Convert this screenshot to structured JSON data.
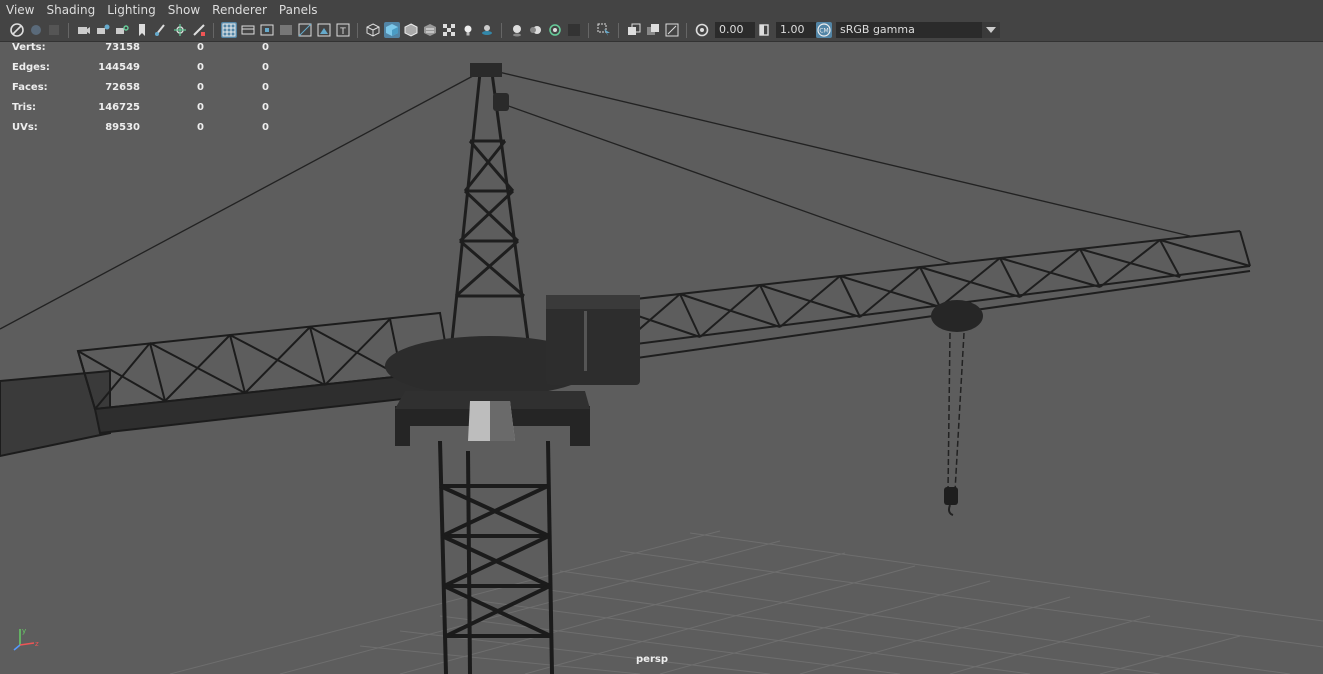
{
  "menu": [
    "View",
    "Shading",
    "Lighting",
    "Show",
    "Renderer",
    "Panels"
  ],
  "toolbar": {
    "exposure": "0.00",
    "gamma": "1.00",
    "color_space": "sRGB gamma"
  },
  "hud": [
    {
      "label": "Verts:",
      "v1": "73158",
      "v2": "0",
      "v3": "0"
    },
    {
      "label": "Edges:",
      "v1": "144549",
      "v2": "0",
      "v3": "0"
    },
    {
      "label": "Faces:",
      "v1": "72658",
      "v2": "0",
      "v3": "0"
    },
    {
      "label": "Tris:",
      "v1": "146725",
      "v2": "0",
      "v3": "0"
    },
    {
      "label": "UVs:",
      "v1": "89530",
      "v2": "0",
      "v3": "0"
    }
  ],
  "camera": "persp",
  "colors": {
    "accent": "#5285a6",
    "viewport_bg": "#5d5d5d",
    "panel_bg": "#444444"
  },
  "icons": [
    "select-camera-icon",
    "camera-attributes-icon",
    "bookmark-icon",
    "grease-pencil-icon",
    "image-plane-icon",
    "grid-icon",
    "film-gate-icon",
    "resolution-gate-icon",
    "gate-mask-icon",
    "field-chart-icon",
    "safe-action-icon",
    "safe-title-icon",
    "wireframe-icon",
    "smooth-shade-icon",
    "wireframe-on-shaded-icon",
    "textured-icon",
    "lights-icon",
    "shadows-icon",
    "ambient-occlusion-icon",
    "motion-blur-icon",
    "anti-aliasing-icon",
    "depth-of-field-icon",
    "isolate-select-icon",
    "xray-icon",
    "xray-joints-icon",
    "xray-components-icon",
    "exposure-icon",
    "gamma-icon",
    "color-management-icon"
  ]
}
